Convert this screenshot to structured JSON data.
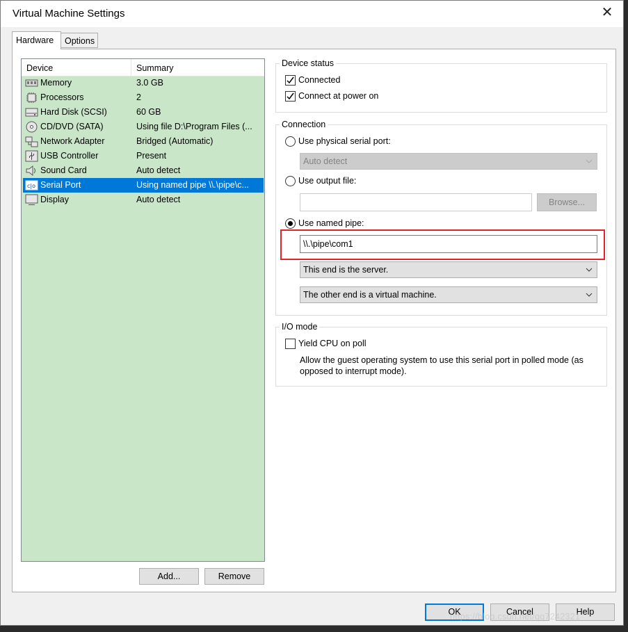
{
  "window": {
    "title": "Virtual Machine Settings",
    "close_glyph": "✕"
  },
  "tabs": [
    {
      "label": "Hardware"
    },
    {
      "label": "Options"
    }
  ],
  "device_list": {
    "col_device": "Device",
    "col_summary": "Summary",
    "rows": [
      {
        "name": "Memory",
        "summary": "3.0 GB",
        "icon": "memory-icon"
      },
      {
        "name": "Processors",
        "summary": "2",
        "icon": "processor-icon"
      },
      {
        "name": "Hard Disk (SCSI)",
        "summary": "60 GB",
        "icon": "hard-disk-icon"
      },
      {
        "name": "CD/DVD (SATA)",
        "summary": "Using file D:\\Program Files (...",
        "icon": "cd-dvd-icon"
      },
      {
        "name": "Network Adapter",
        "summary": "Bridged (Automatic)",
        "icon": "network-adapter-icon"
      },
      {
        "name": "USB Controller",
        "summary": "Present",
        "icon": "usb-icon"
      },
      {
        "name": "Sound Card",
        "summary": "Auto detect",
        "icon": "sound-card-icon"
      },
      {
        "name": "Serial Port",
        "summary": "Using named pipe \\\\.\\pipe\\c...",
        "icon": "serial-port-icon",
        "selected": true
      },
      {
        "name": "Display",
        "summary": "Auto detect",
        "icon": "display-icon"
      }
    ]
  },
  "list_buttons": {
    "add": "Add...",
    "remove": "Remove"
  },
  "device_status": {
    "label": "Device status",
    "connected": {
      "label": "Connected",
      "checked": true
    },
    "connect_at_power_on": {
      "label": "Connect at power on",
      "checked": true
    }
  },
  "connection": {
    "label": "Connection",
    "physical": {
      "label": "Use physical serial port:",
      "selected": false,
      "combo_value": "Auto detect"
    },
    "output_file": {
      "label": "Use output file:",
      "selected": false,
      "value": "",
      "browse": "Browse..."
    },
    "named_pipe": {
      "label": "Use named pipe:",
      "selected": true,
      "value": "\\\\.\\pipe\\com1",
      "end_option": "This end is the server.",
      "other_end_option": "The other end is a virtual machine."
    }
  },
  "io_mode": {
    "label": "I/O mode",
    "yield": {
      "label": "Yield CPU on poll",
      "checked": false
    },
    "description_line1": "Allow the guest operating system to use this serial port in polled mode (as",
    "description_line2": "opposed to interrupt mode)."
  },
  "dialog_buttons": {
    "ok": "OK",
    "cancel": "Cancel",
    "help": "Help"
  },
  "watermark": "https://blog.csdn.net/qq7242321",
  "colors": {
    "selection": "#0078d7",
    "list_bg": "#c9e6c9",
    "highlight": "#e0242a"
  }
}
